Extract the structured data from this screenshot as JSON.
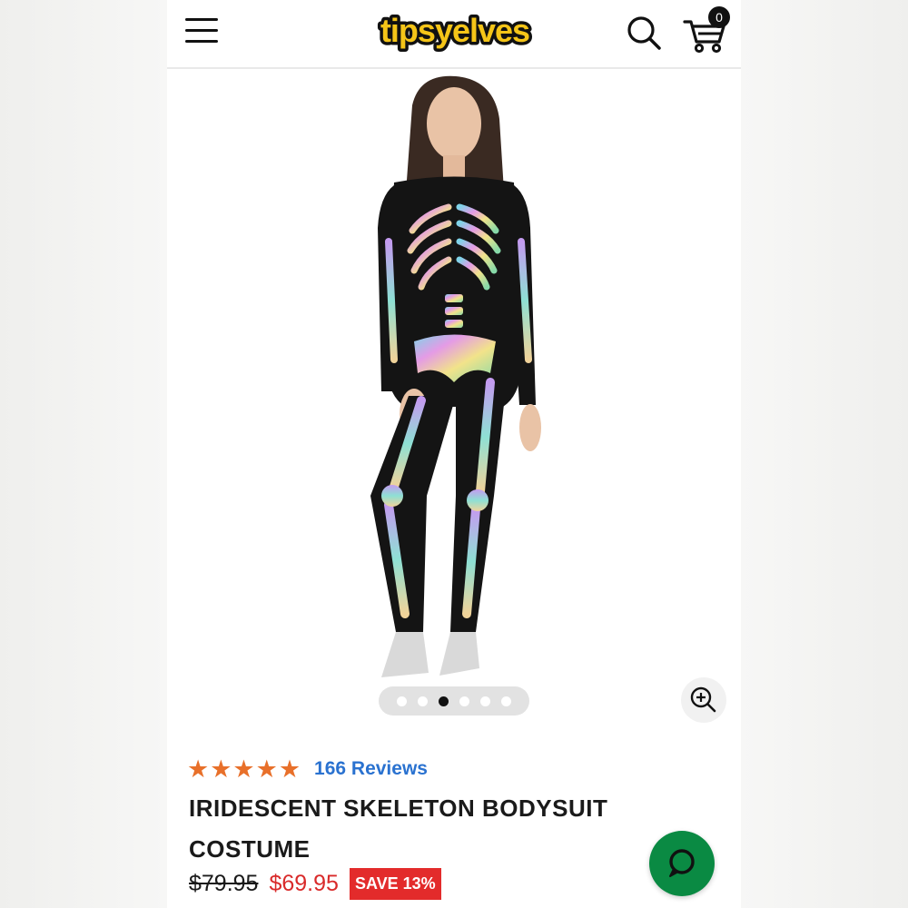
{
  "header": {
    "logo_text": "tipsyelves",
    "cart_count": "0"
  },
  "gallery": {
    "slide_count": 6,
    "active_index": 2
  },
  "product": {
    "rating_stars": "★★★★★",
    "rating": 5,
    "reviews_label": "166 Reviews",
    "title": "IRIDESCENT SKELETON BODYSUIT COSTUME",
    "price_original": "$79.95",
    "price_sale": "$69.95",
    "save_label": "SAVE 13%"
  },
  "colors": {
    "star": "#e8702a",
    "reviews_link": "#2a72d0",
    "sale_price": "#d92a2a",
    "save_badge": "#e32b2b",
    "chat_button": "#0a8a43",
    "logo_yellow": "#f5c518",
    "logo_green": "#3cae3c"
  },
  "icons": {
    "menu": "hamburger-icon",
    "search": "search-icon",
    "cart": "cart-icon",
    "zoom": "zoom-in-icon",
    "chat": "chat-bubble-icon"
  }
}
